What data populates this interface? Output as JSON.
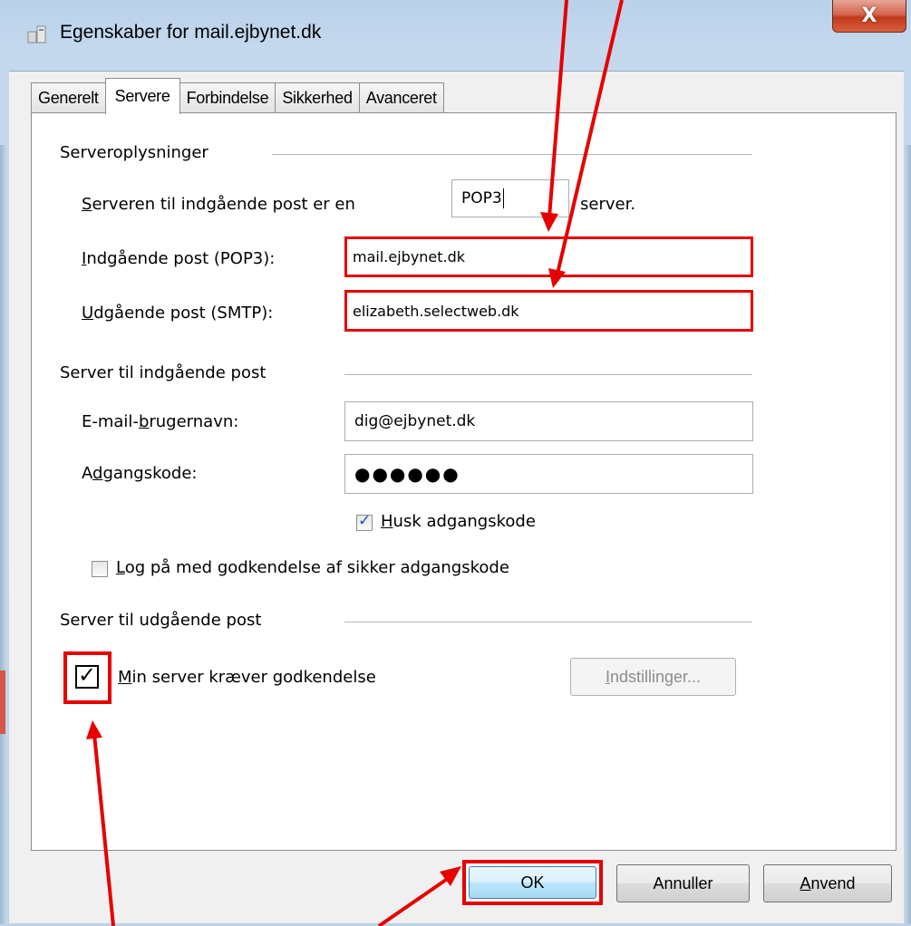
{
  "window": {
    "title": "Egenskaber for mail.ejbynet.dk",
    "close_label": "X"
  },
  "tabs": [
    {
      "label": "Generelt",
      "active": false
    },
    {
      "label": "Servere",
      "active": true
    },
    {
      "label": "Forbindelse",
      "active": false
    },
    {
      "label": "Sikkerhed",
      "active": false
    },
    {
      "label": "Avanceret",
      "active": false
    }
  ],
  "server_info": {
    "group_label": "Serveroplysninger",
    "incoming_type_prefix_u": "S",
    "incoming_type_prefix_rest": "erveren til indgående post er en",
    "incoming_type_value": "POP3",
    "incoming_type_suffix": "server.",
    "incoming_label_u": "I",
    "incoming_label_rest": "ndgående post (POP3):",
    "incoming_value": "mail.ejbynet.dk",
    "outgoing_label_u": "U",
    "outgoing_label_rest": "dgående post (SMTP):",
    "outgoing_value": "elizabeth.selectweb.dk"
  },
  "incoming_server": {
    "group_label": "Server til indgående post",
    "username_label_pre": "E-mail-",
    "username_label_u": "b",
    "username_label_rest": "rugernavn:",
    "username_value": "dig@ejbynet.dk",
    "password_label_pre": "A",
    "password_label_u": "d",
    "password_label_rest": "gangskode:",
    "password_value": "●●●●●●",
    "remember_label_u": "H",
    "remember_label_rest": "usk adgangskode",
    "remember_checked": true,
    "spa_label_u": "L",
    "spa_label_rest": "og på med godkendelse af sikker adgangskode",
    "spa_checked": false
  },
  "outgoing_server": {
    "group_label": "Server til udgående post",
    "auth_label_u": "M",
    "auth_label_rest": "in server kræver godkendelse",
    "auth_checked": true,
    "settings_button_u": "I",
    "settings_button_rest": "ndstillinger..."
  },
  "footer": {
    "ok_label": "OK",
    "cancel_label": "Annuller",
    "apply_label_u": "A",
    "apply_label_rest": "nvend"
  },
  "colors": {
    "highlight_red": "#e60000",
    "close_button": "#c0381c"
  }
}
